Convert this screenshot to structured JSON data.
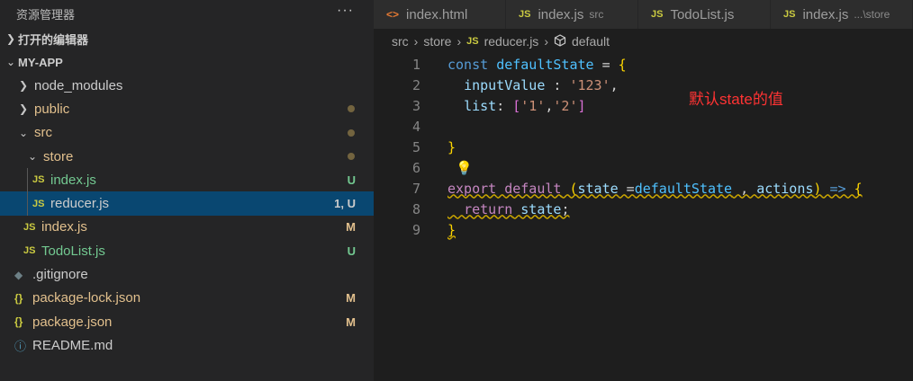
{
  "explorer": {
    "title": "资源管理器",
    "more": "···",
    "open_editors": "打开的编辑器",
    "project": "MY-APP",
    "items": [
      {
        "label": "node_modules",
        "type": "folder",
        "expanded": false,
        "status": ""
      },
      {
        "label": "public",
        "type": "folder",
        "expanded": false,
        "status": "dot"
      },
      {
        "label": "src",
        "type": "folder",
        "expanded": true,
        "status": "dot"
      },
      {
        "label": "store",
        "type": "folder",
        "expanded": true,
        "status": "dot"
      },
      {
        "label": "index.js",
        "type": "js",
        "status": "U"
      },
      {
        "label": "reducer.js",
        "type": "js",
        "status": "1, U",
        "selected": true
      },
      {
        "label": "index.js",
        "type": "js",
        "status": "M"
      },
      {
        "label": "TodoList.js",
        "type": "js",
        "status": "U"
      },
      {
        "label": ".gitignore",
        "type": "git",
        "status": ""
      },
      {
        "label": "package-lock.json",
        "type": "json",
        "status": "M"
      },
      {
        "label": "package.json",
        "type": "json",
        "status": "M"
      },
      {
        "label": "README.md",
        "type": "info",
        "status": ""
      }
    ]
  },
  "tabs": [
    {
      "label": "index.html",
      "icon": "<>",
      "desc": ""
    },
    {
      "label": "index.js",
      "icon": "JS",
      "desc": "src"
    },
    {
      "label": "TodoList.js",
      "icon": "JS",
      "desc": ""
    },
    {
      "label": "index.js",
      "icon": "JS",
      "desc": "...\\store"
    }
  ],
  "breadcrumb": {
    "parts": [
      "src",
      "store",
      "reducer.js",
      "default"
    ]
  },
  "code": {
    "line_numbers": [
      "1",
      "2",
      "3",
      "4",
      "5",
      "6",
      "7",
      "8",
      "9"
    ],
    "annotation": "默认state的值"
  },
  "colors": {
    "selection": "#094771",
    "modified": "#e2c08d",
    "untracked": "#73c991",
    "error": "#f48771"
  }
}
